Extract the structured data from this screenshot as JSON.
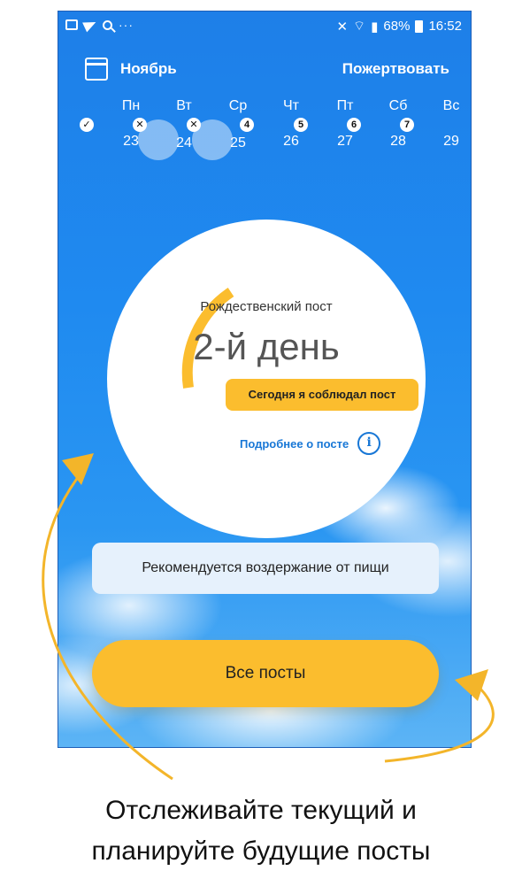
{
  "status_bar": {
    "left_icons": [
      "image-icon",
      "send-icon",
      "search-icon"
    ],
    "more": "···",
    "battery": "68%",
    "time": "16:52"
  },
  "header": {
    "month": "Ноябрь",
    "donate": "Пожертвовать"
  },
  "week": [
    {
      "name": "Пн",
      "num": "23",
      "badge": "✓",
      "selected": false
    },
    {
      "name": "Вт",
      "num": "24",
      "badge": "✕",
      "selected": true
    },
    {
      "name": "Ср",
      "num": "25",
      "badge": "✕",
      "selected": true
    },
    {
      "name": "Чт",
      "num": "26",
      "badge": "4",
      "selected": false
    },
    {
      "name": "Пт",
      "num": "27",
      "badge": "5",
      "selected": false
    },
    {
      "name": "Сб",
      "num": "28",
      "badge": "6",
      "selected": false
    },
    {
      "name": "Вс",
      "num": "29",
      "badge": "7",
      "selected": false
    }
  ],
  "fast": {
    "name": "Рождественский пост",
    "day": "2-й день",
    "observe_button": "Сегодня я соблюдал пост",
    "more_link": "Подробнее о посте",
    "info_icon": "i",
    "progress_color": "#fbbd2e"
  },
  "recommendation": "Рекомендуется воздержание от пищи",
  "all_fasts_button": "Все посты",
  "caption": {
    "line1": "Отслеживайте текущий и",
    "line2": "планируйте будущие посты"
  },
  "colors": {
    "sky": "#1e7fe8",
    "accent": "#fbbd2e",
    "link": "#1877d6"
  }
}
